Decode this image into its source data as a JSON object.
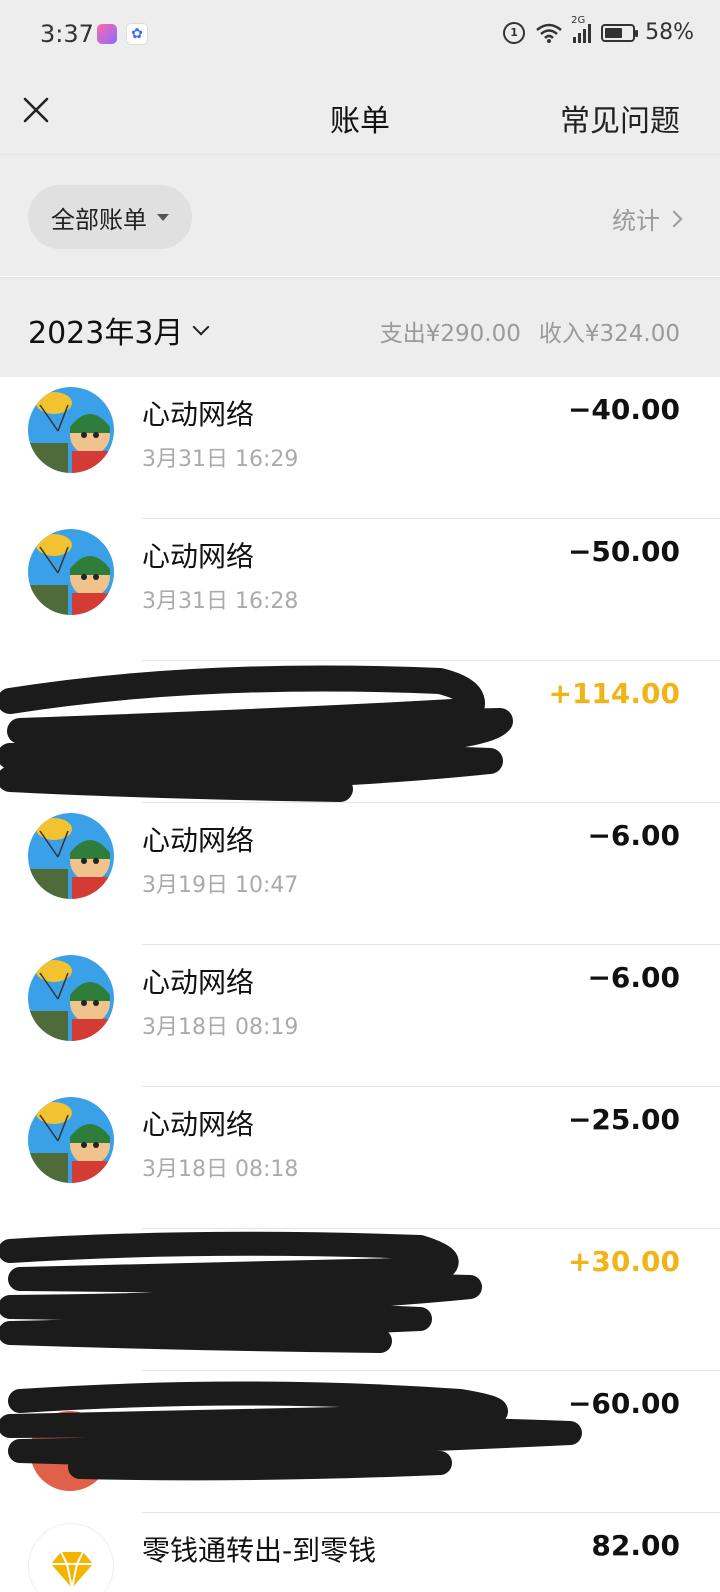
{
  "status_bar": {
    "time": "3:37",
    "network": "2G",
    "battery": "58%"
  },
  "nav": {
    "title": "账单",
    "faq": "常见问题"
  },
  "filter": {
    "chip_label": "全部账单",
    "stats_label": "统计"
  },
  "month": {
    "label": "2023年3月",
    "expense": "支出¥290.00",
    "income": "收入¥324.00"
  },
  "transactions": [
    {
      "merchant": "心动网络",
      "time": "3月31日 16:29",
      "amount": "−40.00",
      "type": "expense",
      "avatar": "game-avatar"
    },
    {
      "merchant": "心动网络",
      "time": "3月31日 16:28",
      "amount": "−50.00",
      "type": "expense",
      "avatar": "game-avatar"
    },
    {
      "merchant": "",
      "time": "",
      "amount": "+114.00",
      "type": "income",
      "avatar": "redacted"
    },
    {
      "merchant": "心动网络",
      "time": "3月19日 10:47",
      "amount": "−6.00",
      "type": "expense",
      "avatar": "game-avatar"
    },
    {
      "merchant": "心动网络",
      "time": "3月18日 08:19",
      "amount": "−6.00",
      "type": "expense",
      "avatar": "game-avatar"
    },
    {
      "merchant": "心动网络",
      "time": "3月18日 08:18",
      "amount": "−25.00",
      "type": "expense",
      "avatar": "game-avatar"
    },
    {
      "merchant": "",
      "time": "",
      "amount": "+30.00",
      "type": "income",
      "avatar": "redacted"
    },
    {
      "merchant": "",
      "time": "",
      "amount": "−60.00",
      "type": "expense",
      "avatar": "redacted"
    },
    {
      "merchant": "零钱通转出-到零钱",
      "time": "",
      "amount": "82.00",
      "type": "transfer",
      "avatar": "diamond-icon"
    }
  ],
  "colors": {
    "header_bg": "#ededed",
    "income": "#f0b416",
    "text": "#111111",
    "muted": "#aaaaaa"
  }
}
